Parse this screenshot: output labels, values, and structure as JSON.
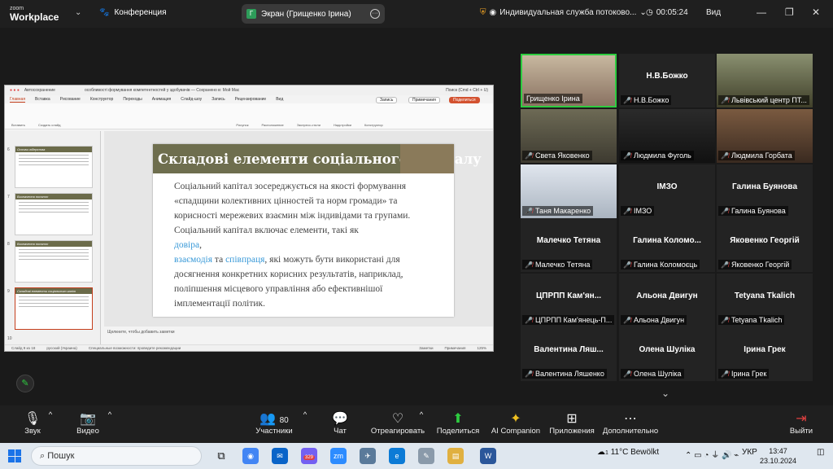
{
  "app": {
    "logo_top": "zoom",
    "logo_bottom": "Workplace",
    "conference": "Конференция",
    "screen_share": "Экран (Грищенко Ірина)",
    "stream_status": "Индивидуальная служба потоково...",
    "timer": "00:05:24",
    "view": "Вид"
  },
  "ppt": {
    "autosave": "Автосохранение",
    "filename": "особливості формування компетентностей у здобувачів — Сохранено в: Мой Mac",
    "search": "Поиск (Cmd + Ctrl + U)",
    "menus": [
      "Главная",
      "Вставка",
      "Рисование",
      "Конструктор",
      "Переходы",
      "Анимация",
      "Слайд-шоу",
      "Запись",
      "Рецензирование",
      "Вид"
    ],
    "record": "Запись",
    "comments": "Примечания",
    "share": "Поделиться",
    "ribbon_labels": [
      "Вставить",
      "Создать слайд",
      "Рисунок",
      "Расположение",
      "Экспресс-стили",
      "Надстройки",
      "Конструктор"
    ],
    "thumbs": [
      {
        "num": "6",
        "title": "Основи лідерства"
      },
      {
        "num": "7",
        "title": "Визначення понятт"
      },
      {
        "num": "8",
        "title": "Визначення понятт"
      },
      {
        "num": "9",
        "title": "Складові елементи соціального капіт"
      },
      {
        "num": "10",
        "title": ""
      }
    ],
    "slide_title": "Складові елементи соціального капіталу",
    "body1": "Соціальний капітал зосереджується на якості формування «спадщини колективних цінностей та норм громади» та корисності мережевих взаємин між індивідами та групами. Соціальний капітал включає елементи, такі як",
    "kw1": "довіра",
    "comma": ",",
    "kw2": "взаємодія",
    "and": " та ",
    "kw3": "співпраця",
    "body2": ", які можуть бути використані для досягнення конкретних корисних результатів, наприклад, поліпшення місцевого управління або ефективнішої імплементації політик.",
    "notes": "Щелкните, чтобы добавить заметки",
    "status": [
      "Слайд 9 из 18",
      "русский (Украина)",
      "Специальные возможности: проведите рекомендации",
      "Заметки",
      "Примечания",
      "125%"
    ]
  },
  "participants": [
    {
      "title": "",
      "label": "Грищенко Ірина",
      "video": "vid1",
      "muted": false,
      "active": true
    },
    {
      "title": "Н.В.Божко",
      "label": "Н.В.Божко",
      "video": "",
      "muted": true
    },
    {
      "title": "",
      "label": "Львівський центр ПТ...",
      "video": "vid6",
      "muted": true
    },
    {
      "title": "",
      "label": "Света Яковенко",
      "video": "vid2",
      "muted": true
    },
    {
      "title": "",
      "label": "Людмила Фуголь",
      "video": "vid3",
      "muted": true
    },
    {
      "title": "",
      "label": "Людмила Горбата",
      "video": "vid4",
      "muted": true
    },
    {
      "title": "",
      "label": "Таня Макаренко",
      "video": "vid5",
      "muted": true
    },
    {
      "title": "ІМЗО",
      "label": "ІМЗО",
      "video": "",
      "muted": true
    },
    {
      "title": "Галина Буянова",
      "label": "Галина Буянова",
      "video": "",
      "muted": true
    },
    {
      "title": "Малечко Тетяна",
      "label": "Малечко Тетяна",
      "video": "",
      "muted": true
    },
    {
      "title": "Галина Коломо...",
      "label": "Галина Коломоєць",
      "video": "",
      "muted": true
    },
    {
      "title": "Яковенко Георгій",
      "label": "Яковенко Георгій",
      "video": "",
      "muted": true
    },
    {
      "title": "ЦПРПП Кам'ян...",
      "label": "ЦПРПП Кам'янець-П...",
      "video": "",
      "muted": true
    },
    {
      "title": "Альона Двигун",
      "label": "Альона Двигун",
      "video": "",
      "muted": true
    },
    {
      "title": "Tetyana Tkalich",
      "label": "Tetyana Tkalich",
      "video": "",
      "muted": true
    },
    {
      "title": "Валентина Ляш...",
      "label": "Валентина Ляшенко",
      "video": "",
      "muted": true
    },
    {
      "title": "Олена Шуліка",
      "label": "Олена Шуліка",
      "video": "",
      "muted": true
    },
    {
      "title": "Ірина Грек",
      "label": "Ірина Грек",
      "video": "",
      "muted": true
    }
  ],
  "toolbar": {
    "audio": "Звук",
    "video": "Видео",
    "participants": "Участники",
    "participants_count": "80",
    "chat": "Чат",
    "react": "Отреагировать",
    "share": "Поделиться",
    "ai": "AI Companion",
    "apps": "Приложения",
    "more": "Дополнительно",
    "leave": "Выйти"
  },
  "taskbar": {
    "search": "Пошук",
    "badge": "329",
    "weather_temp": "11°C",
    "weather_text": "Bewölkt",
    "lang": "УКР",
    "time": "13:47",
    "date": "23.10.2024",
    "notify": "1"
  }
}
